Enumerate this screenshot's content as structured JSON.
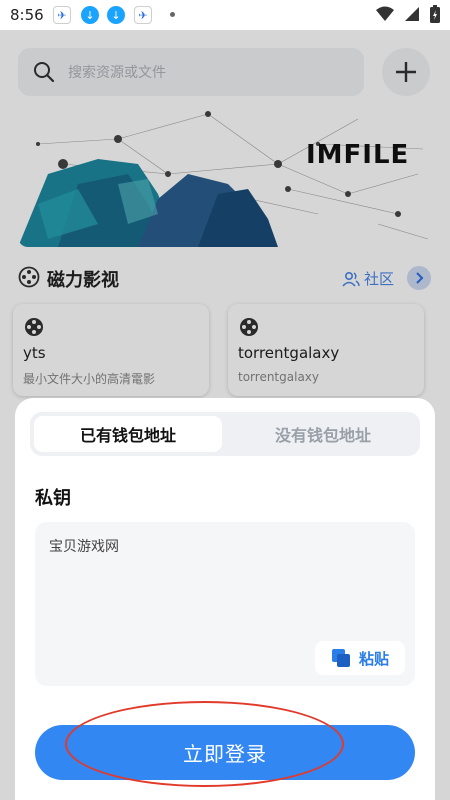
{
  "status_bar": {
    "time": "8:56",
    "icons": [
      "app-notification-icon",
      "download-notification-icon",
      "download-notification-icon",
      "app-notification-icon",
      "more-dot",
      "wifi-icon",
      "signal-icon",
      "battery-charging-icon"
    ]
  },
  "search": {
    "placeholder": "搜索资源或文件"
  },
  "banner": {
    "title": "IMFILE"
  },
  "section": {
    "title": "磁力影视",
    "community_label": "社区"
  },
  "cards": [
    {
      "name": "yts",
      "desc": "最小文件大小的高清電影"
    },
    {
      "name": "torrentgalaxy",
      "desc": "torrentgalaxy"
    }
  ],
  "sheet": {
    "tabs": [
      {
        "label": "已有钱包地址",
        "active": true
      },
      {
        "label": "没有钱包地址",
        "active": false
      }
    ],
    "field_label": "私钥",
    "key_value": "宝贝游戏网",
    "paste_label": "粘贴",
    "login_label": "立即登录"
  },
  "colors": {
    "accent": "#3387f3",
    "highlight_ring": "#e23a2a",
    "banner_teal": "#1f8ea0"
  }
}
